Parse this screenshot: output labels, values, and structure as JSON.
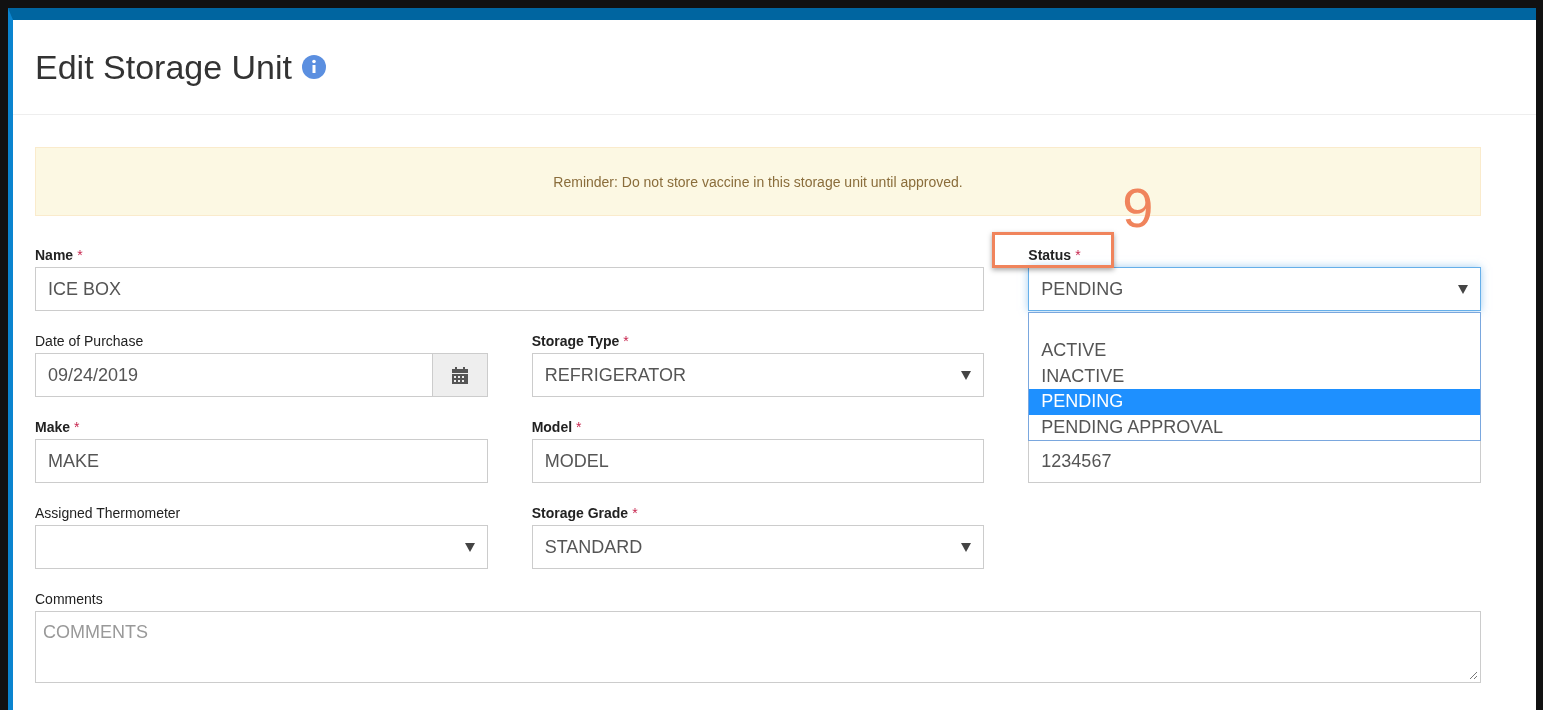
{
  "page": {
    "title": "Edit Storage Unit"
  },
  "alert": {
    "text": "Reminder: Do not store vaccine in this storage unit until approved."
  },
  "rows": [
    {
      "fields": [
        {
          "label": "Name",
          "mark": "*",
          "kind": "text",
          "value": "ICE BOX",
          "wide": true
        },
        {
          "label": "Status",
          "mark": "*",
          "kind": "select",
          "value": "PENDING",
          "expanded": true,
          "annotation": "9",
          "options": [
            {
              "label": "ACTIVE",
              "selected": false
            },
            {
              "label": "INACTIVE",
              "selected": false
            },
            {
              "label": "PENDING",
              "selected": true
            },
            {
              "label": "PENDING APPROVAL",
              "selected": false
            }
          ]
        }
      ]
    },
    {
      "fields": [
        {
          "label": "Date of Purchase",
          "kind": "date",
          "value": "09/24/2019"
        },
        {
          "label": "Storage Type",
          "mark": "*",
          "kind": "select",
          "value": "REFRIGERATOR"
        }
      ]
    },
    {
      "fields": [
        {
          "label": "Make",
          "mark": "*",
          "kind": "text",
          "value": "MAKE"
        },
        {
          "label": "Model",
          "mark": "*",
          "kind": "text",
          "value": "MODEL"
        },
        {
          "kind": "text",
          "value": "1234567"
        }
      ]
    },
    {
      "fields": [
        {
          "label": "Assigned Thermometer",
          "kind": "select"
        },
        {
          "label": "Storage Grade",
          "mark": "*",
          "kind": "select",
          "value": "STANDARD"
        }
      ]
    },
    {
      "fields": [
        {
          "label": "Comments",
          "kind": "textarea",
          "placeholder": "COMMENTS",
          "wide": true
        }
      ]
    }
  ]
}
